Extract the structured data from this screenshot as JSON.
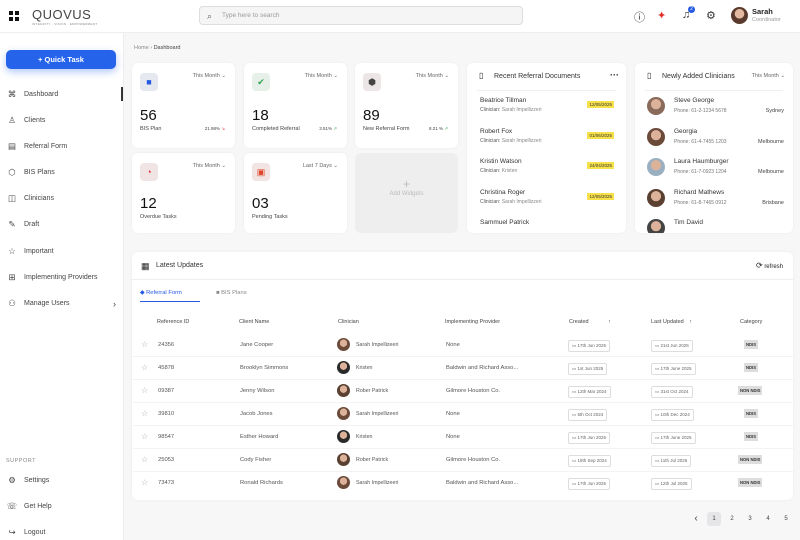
{
  "header": {
    "logo": "QUOVUS",
    "logo_tagline": "INTEGRITY · VISION · EMPOWERMENT",
    "search_placeholder": "Type here to search",
    "notification_count": "2",
    "user_name": "Sarah",
    "user_role": "Coordinator"
  },
  "sidebar": {
    "quick_task": "Quick Task",
    "items": [
      {
        "label": "Dashboard",
        "icon": "⌘"
      },
      {
        "label": "Clients",
        "icon": "♙"
      },
      {
        "label": "Referral Form",
        "icon": "▤"
      },
      {
        "label": "BIS Plans",
        "icon": "⬡"
      },
      {
        "label": "Clinicians",
        "icon": "◫"
      },
      {
        "label": "Draft",
        "icon": "✎"
      },
      {
        "label": "Important",
        "icon": "☆"
      },
      {
        "label": "Implementing Providers",
        "icon": "⊞"
      },
      {
        "label": "Manage Users",
        "icon": "⚇"
      }
    ],
    "support_label": "SUPPORT",
    "support_items": [
      {
        "label": "Settings",
        "icon": "⚙"
      },
      {
        "label": "Get Help",
        "icon": "☏"
      },
      {
        "label": "Logout",
        "icon": "↪"
      }
    ]
  },
  "breadcrumb": {
    "home": "Home",
    "current": "Dashboard"
  },
  "stats": [
    {
      "value": "56",
      "label": "BIS Plan",
      "period": "This Month",
      "pct": "21.98%",
      "trend": "↘",
      "icon": "■",
      "color": "#2459e0",
      "bg": "#e6e8ef"
    },
    {
      "value": "18",
      "label": "Completed Referral",
      "period": "This Month",
      "pct": "3.51%",
      "trend": "↗",
      "icon": "✔",
      "color": "#2da44e",
      "bg": "#e6efe8"
    },
    {
      "value": "89",
      "label": "New Referral Form",
      "period": "This Month",
      "pct": "8.21 %",
      "trend": "↗",
      "icon": "⬢",
      "color": "#444",
      "bg": "#ece6e6"
    },
    {
      "value": "12",
      "label": "Overdue Tasks",
      "period": "This Month",
      "icon": "◔",
      "color": "#d8222a",
      "bg": "#f1e4e4"
    },
    {
      "value": "03",
      "label": "Pending Tasks",
      "period": "Last 7 Days",
      "icon": "▣",
      "color": "#e0442a",
      "bg": "#f1e4e2"
    }
  ],
  "add_widgets": "Add Widgets",
  "referrals": {
    "title": "Recent Referral Documents",
    "items": [
      {
        "name": "Beatrice Tillman",
        "clinician_label": "Clinician:",
        "clinician": "Sarah Impellizzeri",
        "date": "12/05/2025"
      },
      {
        "name": "Robert Fox",
        "clinician_label": "Clinician:",
        "clinician": "Sarah Impellizzeri",
        "date": "01/06/2025"
      },
      {
        "name": "Kristin Watson",
        "clinician_label": "Clinician:",
        "clinician": "Kristen",
        "date": "24/04/2025"
      },
      {
        "name": "Christina Roger",
        "clinician_label": "Clinician:",
        "clinician": "Sarah Impellizzeri",
        "date": "12/05/2025"
      },
      {
        "name": "Sammuel Patrick",
        "clinician_label": "",
        "clinician": "",
        "date": ""
      }
    ]
  },
  "clinicians": {
    "title": "Newly Added Clinicians",
    "period": "This Month",
    "items": [
      {
        "name": "Steve George",
        "phone": "Phone: 61-2-1234 5678",
        "city": "Sydney"
      },
      {
        "name": "Georgia",
        "phone": "Phone: 61-4-7455 1203",
        "city": "Melbourne"
      },
      {
        "name": "Laura Haumburger",
        "phone": "Phone: 61-7-0923 1204",
        "city": "Melbourne"
      },
      {
        "name": "Richard Mathews",
        "phone": "Phone: 61-8-7465 0912",
        "city": "Brisbane"
      },
      {
        "name": "Tim David",
        "phone": "",
        "city": ""
      }
    ]
  },
  "updates": {
    "title": "Latest Updates",
    "refresh": "refresh",
    "tabs": [
      "Referral Form",
      "BIS Plans"
    ],
    "columns": [
      "Reference  ID",
      "Client Name",
      "Clinician",
      "Implementing Provider",
      "Created",
      "Last Updated",
      "Category"
    ],
    "rows": [
      {
        "id": "24356",
        "client": "Jane Cooper",
        "clinician": "Sarah Impellizeeri",
        "provider": "None",
        "created": "17th Jun 2025",
        "updated": "21st Jun 2025",
        "category": "NDIS"
      },
      {
        "id": "45878",
        "client": "Brooklyn Simmons",
        "clinician": "Kristen",
        "provider": "Baldwin and Richard Asso...",
        "created": "1st Jun 2025",
        "updated": "17th June 2025",
        "category": "NDIS"
      },
      {
        "id": "09387",
        "client": "Jenny Wilson",
        "clinician": "Rober Patrick",
        "provider": "Gilmore Houston Co.",
        "created": "12th Mar 2024",
        "updated": "31st Oct 2024",
        "category": "NON NDIS"
      },
      {
        "id": "39810",
        "client": "Jacob Jones",
        "clinician": "Sarah Impellizeeri",
        "provider": "None",
        "created": "5th Oct 2024",
        "updated": "10th Dec 2024",
        "category": "NDIS"
      },
      {
        "id": "98547",
        "client": "Esther Howard",
        "clinician": "Kristen",
        "provider": "None",
        "created": "17th Jun 2025",
        "updated": "17th June 2025",
        "category": "NDIS"
      },
      {
        "id": "25053",
        "client": "Cody Fisher",
        "clinician": "Rober Patrick",
        "provider": "Gilmore Houston Co.",
        "created": "18th Sep 2024",
        "updated": "11th Jul 2025",
        "category": "NON NDIS"
      },
      {
        "id": "73473",
        "client": "Ronald Richards",
        "clinician": "Sarah Impellizeeri",
        "provider": "Baldwin and Richard Asso...",
        "created": "17th Jun 2025",
        "updated": "12th Jul 2025",
        "category": "NON NDIS"
      }
    ]
  },
  "pagination": {
    "prev": "‹",
    "pages": [
      "1",
      "2",
      "3",
      "4",
      "5"
    ],
    "current": "1"
  }
}
